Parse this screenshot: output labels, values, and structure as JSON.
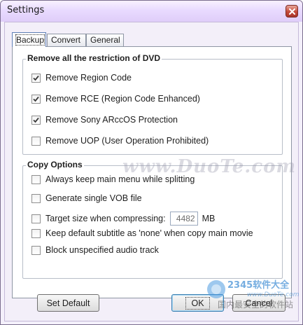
{
  "window": {
    "title": "Settings"
  },
  "tabs": [
    "Backup",
    "Convert",
    "General"
  ],
  "active_tab": "Backup",
  "dvd_group": {
    "title": "Remove all the restriction of DVD",
    "options": [
      {
        "label": "Remove Region Code",
        "checked": true
      },
      {
        "label": "Remove RCE (Region Code Enhanced)",
        "checked": true
      },
      {
        "label": "Remove Sony ARccOS Protection",
        "checked": true
      },
      {
        "label": "Remove UOP (User Operation Prohibited)",
        "checked": false
      }
    ]
  },
  "copy_group": {
    "title": "Copy Options",
    "options": [
      {
        "label": "Always keep main menu while splitting",
        "checked": false
      },
      {
        "label": "Generate single VOB file",
        "checked": false
      },
      {
        "label": "Target size when compressing:",
        "checked": false
      },
      {
        "label": "Keep default subtitle as 'none' when copy main movie",
        "checked": false
      },
      {
        "label": "Block unspecified audio track",
        "checked": false
      }
    ],
    "target_size_value": "4482",
    "target_size_unit": "MB"
  },
  "buttons": {
    "set_default": "Set Default",
    "ok": "OK",
    "cancel": "Cancel"
  },
  "watermarks": {
    "center": "www.DuoTe.com",
    "corner_brand": "2345软件大全",
    "corner_url": "www.DuoTe.com",
    "corner_slogan": "国内最安全的软件站"
  },
  "colors": {
    "check_mark": "#3a3a3a",
    "close_button": "#c44a3a"
  }
}
